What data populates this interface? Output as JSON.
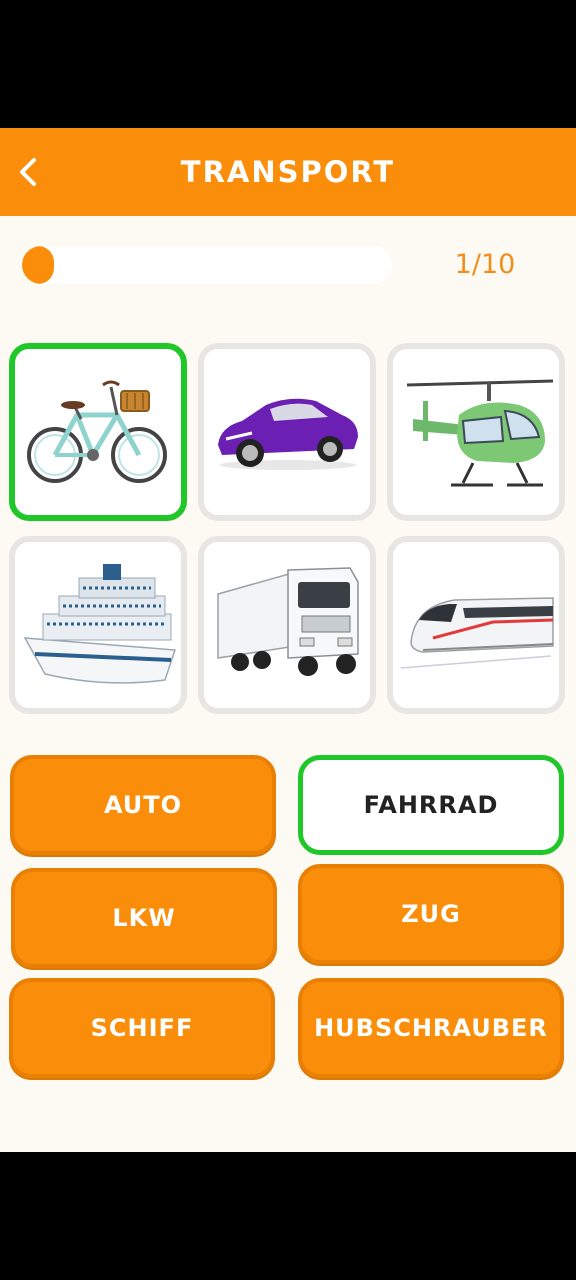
{
  "header": {
    "title": "TRANSPORT"
  },
  "progress": {
    "text": "1/10",
    "fraction": 0.1
  },
  "tiles": [
    {
      "icon": "bicycle-icon",
      "selected": true
    },
    {
      "icon": "car-icon",
      "selected": false
    },
    {
      "icon": "helicopter-icon",
      "selected": false
    },
    {
      "icon": "ship-icon",
      "selected": false
    },
    {
      "icon": "truck-icon",
      "selected": false
    },
    {
      "icon": "train-icon",
      "selected": false
    }
  ],
  "answers": [
    {
      "label": "AUTO",
      "selected": false
    },
    {
      "label": "FAHRRAD",
      "selected": true
    },
    {
      "label": "LKW",
      "selected": false
    },
    {
      "label": "ZUG",
      "selected": false
    },
    {
      "label": "SCHIFF",
      "selected": false
    },
    {
      "label": "HUBSCHRAUBER",
      "selected": false
    }
  ],
  "colors": {
    "accent": "#fa8e0a",
    "selected": "#1fc729",
    "background": "#fdfaf4"
  }
}
